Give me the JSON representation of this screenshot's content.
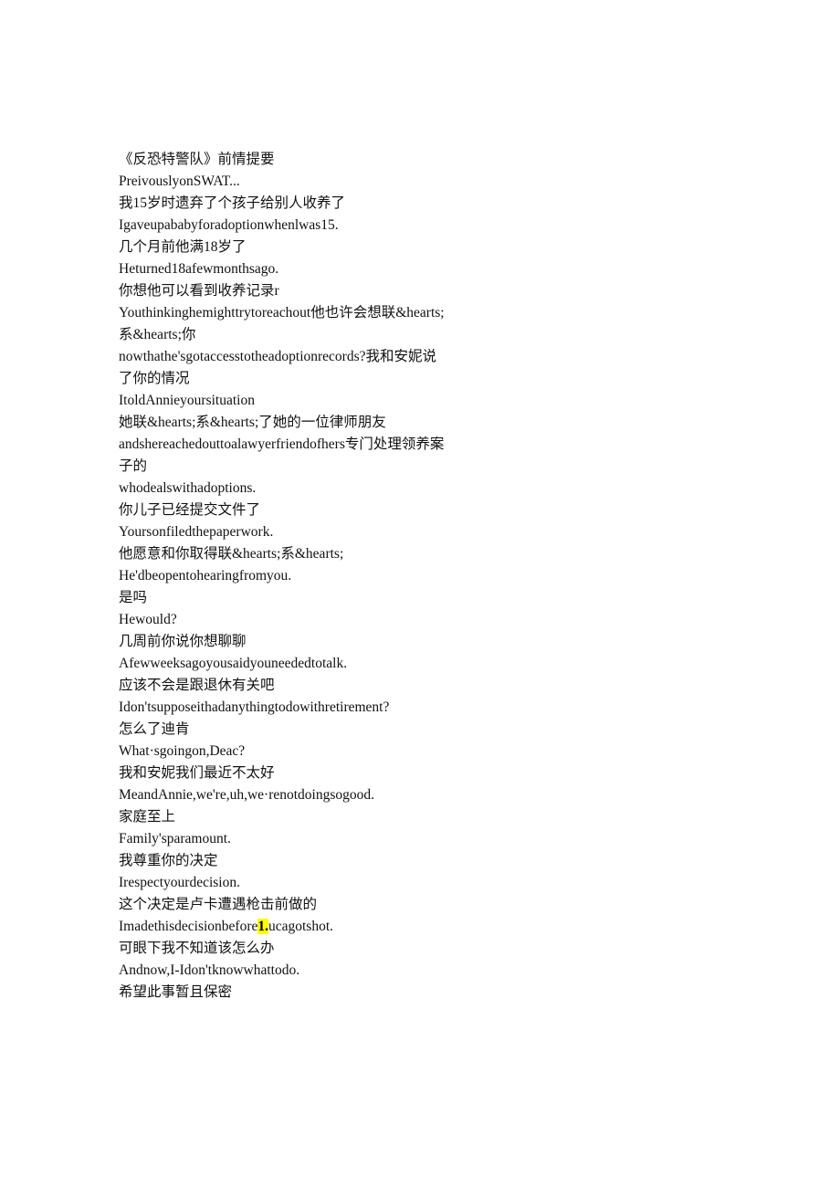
{
  "document": {
    "title": "《反恐特警队》前情提要",
    "highlight_color": "#ffff00",
    "text_color": "#111111",
    "background_color": "#ffffff"
  },
  "lines": [
    {
      "id": "title-zh",
      "lang": "zh",
      "text": "《反恐特警队》前情提要"
    },
    {
      "id": "title-en",
      "lang": "en",
      "text": "PreivouslyonSWAT..."
    },
    {
      "id": "cue1-zh",
      "lang": "zh",
      "text": "我15岁时遗弃了个孩子给别人收养了"
    },
    {
      "id": "cue1-en",
      "lang": "en",
      "text": "Igaveupababyforadoptionwhenlwas15."
    },
    {
      "id": "cue2-zh",
      "lang": "zh",
      "text": "几个月前他满18岁了"
    },
    {
      "id": "cue2-en",
      "lang": "en",
      "text": "Heturned18afewmonthsago."
    },
    {
      "id": "cue3-zh",
      "lang": "zh",
      "text": "你想他可以看到收养记录r"
    },
    {
      "id": "cue3-en",
      "lang": "en",
      "text": "Youthinkinghemighttrytoreachout他也许会想联&hearts;系&hearts;你"
    },
    {
      "id": "cue3-en2",
      "lang": "en",
      "text": "nowthathe'sgotaccesstotheadoptionrecords?我和安妮说了你的情况"
    },
    {
      "id": "cue3-en3",
      "lang": "en",
      "text": "ItoldAnnieyoursituation"
    },
    {
      "id": "cue4-zh",
      "lang": "zh",
      "text": "她联&hearts;系&hearts;了她的一位律师朋友"
    },
    {
      "id": "cue4-en",
      "lang": "en",
      "text": "andshereachedouttoalawyerfriendofhers专门处理领养案子的"
    },
    {
      "id": "cue4-en2",
      "lang": "en",
      "text": "whodealswithadoptions."
    },
    {
      "id": "cue5-zh",
      "lang": "zh",
      "text": "你儿子已经提交文件了"
    },
    {
      "id": "cue5-en",
      "lang": "en",
      "text": "Yoursonfiledthepaperwork."
    },
    {
      "id": "cue6-zh",
      "lang": "zh",
      "text": "他愿意和你取得联&hearts;系&hearts;"
    },
    {
      "id": "cue6-en",
      "lang": "en",
      "text": "He'dbeopentohearingfromyou."
    },
    {
      "id": "cue7-zh",
      "lang": "zh",
      "text": "是吗"
    },
    {
      "id": "cue7-en",
      "lang": "en",
      "text": "Hewould?"
    },
    {
      "id": "cue8-zh",
      "lang": "zh",
      "text": "几周前你说你想聊聊"
    },
    {
      "id": "cue8-en",
      "lang": "en",
      "text": "Afewweeksagoyousaidyouneededtotalk."
    },
    {
      "id": "cue9-zh",
      "lang": "zh",
      "text": "应该不会是跟退休有关吧"
    },
    {
      "id": "cue9-en",
      "lang": "en",
      "text": "Idon'tsupposeithadanythingtodowithretirement?"
    },
    {
      "id": "cue10-zh",
      "lang": "zh",
      "text": "怎么了迪肯"
    },
    {
      "id": "cue10-en",
      "lang": "en",
      "text": "What·sgoingon,Deac?"
    },
    {
      "id": "cue11-zh",
      "lang": "zh",
      "text": "我和安妮我们最近不太好"
    },
    {
      "id": "cue11-en",
      "lang": "en",
      "text": "MeandAnnie,we're,uh,we·renotdoingsogood."
    },
    {
      "id": "cue12-zh",
      "lang": "zh",
      "text": "家庭至上"
    },
    {
      "id": "cue12-en",
      "lang": "en",
      "text": "Family'sparamount."
    },
    {
      "id": "cue13-zh",
      "lang": "zh",
      "text": "我尊重你的决定"
    },
    {
      "id": "cue13-en",
      "lang": "en",
      "text": "Irespectyourdecision."
    },
    {
      "id": "cue14-zh",
      "lang": "zh",
      "text": "这个决定是卢卡遭遇枪击前做的"
    },
    {
      "id": "cue14-en",
      "lang": "en",
      "segments": [
        {
          "text": "Imadethisdecisionbefore",
          "highlight": false
        },
        {
          "text": "1.",
          "highlight": true
        },
        {
          "text": "ucagotshot.",
          "highlight": false
        }
      ]
    },
    {
      "id": "cue15-zh",
      "lang": "zh",
      "text": "可眼下我不知道该怎么办"
    },
    {
      "id": "cue15-en",
      "lang": "en",
      "text": "Andnow,I-Idon'tknowwhattodo."
    },
    {
      "id": "cue16-zh",
      "lang": "zh",
      "text": "希望此事暂且保密"
    }
  ]
}
